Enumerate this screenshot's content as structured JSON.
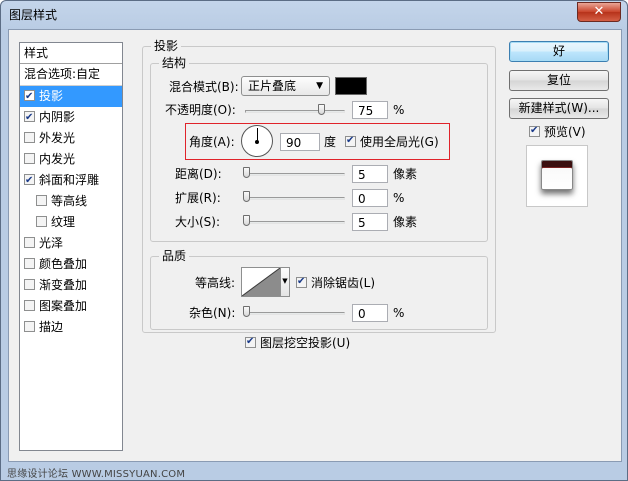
{
  "window": {
    "title": "图层样式",
    "close_label": "✕"
  },
  "style_list": {
    "header": "样式",
    "items": [
      {
        "label": "混合选项:自定",
        "checkbox": false,
        "checked": false,
        "indent": false,
        "selected": false
      },
      {
        "label": "投影",
        "checkbox": true,
        "checked": true,
        "indent": false,
        "selected": true
      },
      {
        "label": "内阴影",
        "checkbox": true,
        "checked": true,
        "indent": false,
        "selected": false
      },
      {
        "label": "外发光",
        "checkbox": true,
        "checked": false,
        "indent": false,
        "selected": false
      },
      {
        "label": "内发光",
        "checkbox": true,
        "checked": false,
        "indent": false,
        "selected": false
      },
      {
        "label": "斜面和浮雕",
        "checkbox": true,
        "checked": true,
        "indent": false,
        "selected": false
      },
      {
        "label": "等高线",
        "checkbox": true,
        "checked": false,
        "indent": true,
        "selected": false
      },
      {
        "label": "纹理",
        "checkbox": true,
        "checked": false,
        "indent": true,
        "selected": false
      },
      {
        "label": "光泽",
        "checkbox": true,
        "checked": false,
        "indent": false,
        "selected": false
      },
      {
        "label": "颜色叠加",
        "checkbox": true,
        "checked": false,
        "indent": false,
        "selected": false
      },
      {
        "label": "渐变叠加",
        "checkbox": true,
        "checked": false,
        "indent": false,
        "selected": false
      },
      {
        "label": "图案叠加",
        "checkbox": true,
        "checked": false,
        "indent": false,
        "selected": false
      },
      {
        "label": "描边",
        "checkbox": true,
        "checked": false,
        "indent": false,
        "selected": false
      }
    ]
  },
  "drop_shadow": {
    "section_title": "投影",
    "structure_title": "结构",
    "blend_mode_label": "混合模式(B):",
    "blend_mode_value": "正片叠底",
    "blend_color": "#000000",
    "opacity_label": "不透明度(O):",
    "opacity_value": "75",
    "opacity_unit": "%",
    "angle_label": "角度(A):",
    "angle_value": "90",
    "angle_unit": "度",
    "global_light_label": "使用全局光(G)",
    "global_light_checked": true,
    "distance_label": "距离(D):",
    "distance_value": "5",
    "distance_unit": "像素",
    "spread_label": "扩展(R):",
    "spread_value": "0",
    "spread_unit": "%",
    "size_label": "大小(S):",
    "size_value": "5",
    "size_unit": "像素",
    "quality_title": "品质",
    "contour_label": "等高线:",
    "anti_aliased_label": "消除锯齿(L)",
    "anti_aliased_checked": true,
    "noise_label": "杂色(N):",
    "noise_value": "0",
    "noise_unit": "%",
    "knockout_label": "图层挖空投影(U)",
    "knockout_checked": true
  },
  "buttons": {
    "ok": "好",
    "reset": "复位",
    "new_style": "新建样式(W)...",
    "preview_label": "预览(V)",
    "preview_checked": true
  },
  "watermark": "思缘设计论坛 WWW.MISSYUAN.COM"
}
